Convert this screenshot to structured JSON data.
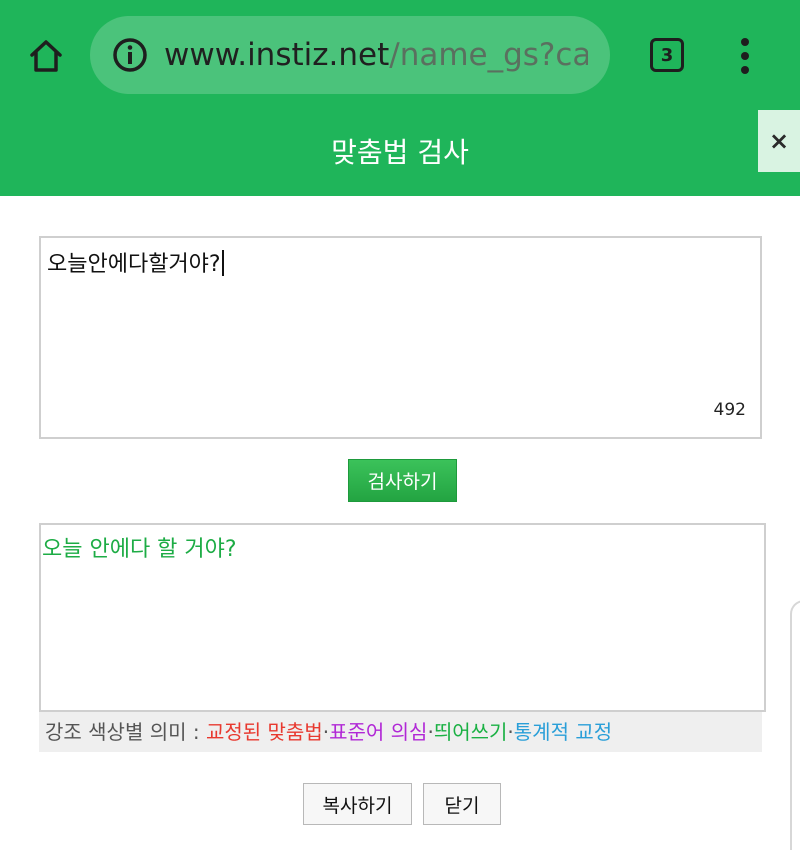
{
  "browser": {
    "url_host": "www.instiz.net",
    "url_path": "/name_gs?ca",
    "tab_count": "3",
    "icons": {
      "home": "home-icon",
      "info": "info-icon",
      "tabs": "tab-switcher-icon",
      "menu": "more-vert-icon"
    }
  },
  "header": {
    "title": "맞춤법 검사",
    "close_label": "×"
  },
  "input": {
    "value": "오늘안에다할거야?",
    "char_count": "492"
  },
  "check_button": {
    "label": "검사하기"
  },
  "result": {
    "text": "오늘 안에다 할 거야?"
  },
  "legend": {
    "label": "강조 색상별 의미 : ",
    "items": [
      {
        "label": "교정된 맞춤법",
        "color": "#e8392f"
      },
      {
        "label": "표준어 의심",
        "color": "#b128d6"
      },
      {
        "label": "띄어쓰기",
        "color": "#1bb144"
      },
      {
        "label": "통계적 교정",
        "color": "#2a9fd8"
      }
    ],
    "separator": "·"
  },
  "footer": {
    "copy_label": "복사하기",
    "close_label": "닫기"
  },
  "colors": {
    "brand_green": "#1fb55a",
    "result_text": "#1dac45"
  }
}
